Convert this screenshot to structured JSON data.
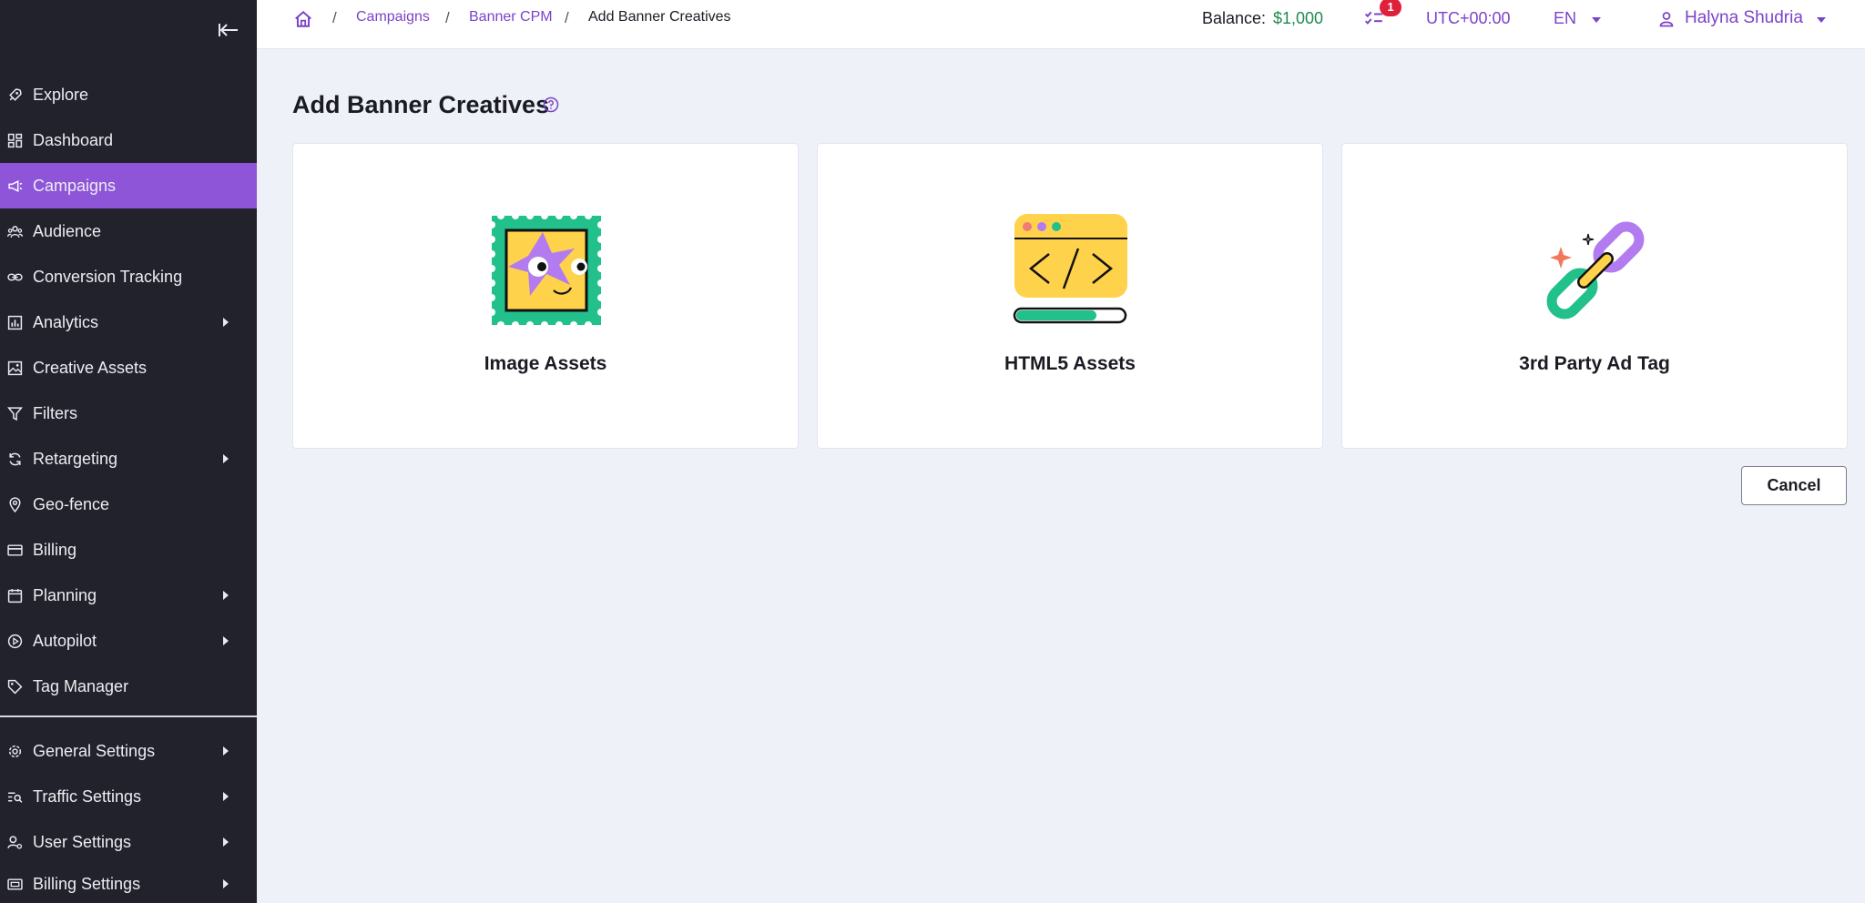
{
  "sidebar": {
    "items": [
      {
        "label": "Explore",
        "icon": "rocket-icon"
      },
      {
        "label": "Dashboard",
        "icon": "dashboard-icon"
      },
      {
        "label": "Campaigns",
        "icon": "megaphone-icon",
        "active": true
      },
      {
        "label": "Audience",
        "icon": "audience-icon"
      },
      {
        "label": "Conversion Tracking",
        "icon": "link-icon"
      },
      {
        "label": "Analytics",
        "icon": "chart-icon",
        "expandable": true
      },
      {
        "label": "Creative Assets",
        "icon": "image-icon"
      },
      {
        "label": "Filters",
        "icon": "filter-icon"
      },
      {
        "label": "Retargeting",
        "icon": "refresh-icon",
        "expandable": true
      },
      {
        "label": "Geo-fence",
        "icon": "map-pin-icon"
      },
      {
        "label": "Billing",
        "icon": "card-icon"
      },
      {
        "label": "Planning",
        "icon": "calendar-icon",
        "expandable": true
      },
      {
        "label": "Autopilot",
        "icon": "play-circle-icon",
        "expandable": true
      },
      {
        "label": "Tag Manager",
        "icon": "tag-icon"
      },
      {
        "label": "General Settings",
        "icon": "gear-icon",
        "expandable": true
      },
      {
        "label": "Traffic Settings",
        "icon": "traffic-list-icon",
        "expandable": true
      },
      {
        "label": "User Settings",
        "icon": "user-settings-icon",
        "expandable": true
      },
      {
        "label": "Billing Settings",
        "icon": "billing-settings-icon",
        "expandable": true
      }
    ]
  },
  "breadcrumb": {
    "items": [
      "Campaigns",
      "Banner CPM"
    ],
    "current": "Add Banner Creatives",
    "separator": "/"
  },
  "header": {
    "balance_label": "Balance:",
    "balance_value": "$1,000",
    "notification_count": "1",
    "timezone": "UTC+00:00",
    "language": "EN",
    "user_name": "Halyna Shudria"
  },
  "main": {
    "title": "Add Banner Creatives",
    "cards": [
      {
        "label": "Image Assets",
        "icon": "stamp-image-icon"
      },
      {
        "label": "HTML5 Assets",
        "icon": "code-window-icon"
      },
      {
        "label": "3rd Party Ad Tag",
        "icon": "chain-link-icon"
      }
    ],
    "cancel_label": "Cancel"
  },
  "colors": {
    "sidebar_bg": "#22222c",
    "active_item": "#8f55d9",
    "accent": "#7b43c9",
    "balance_green": "#1f8a52",
    "badge_red": "#e0203a",
    "page_bg": "#eef1f8"
  }
}
